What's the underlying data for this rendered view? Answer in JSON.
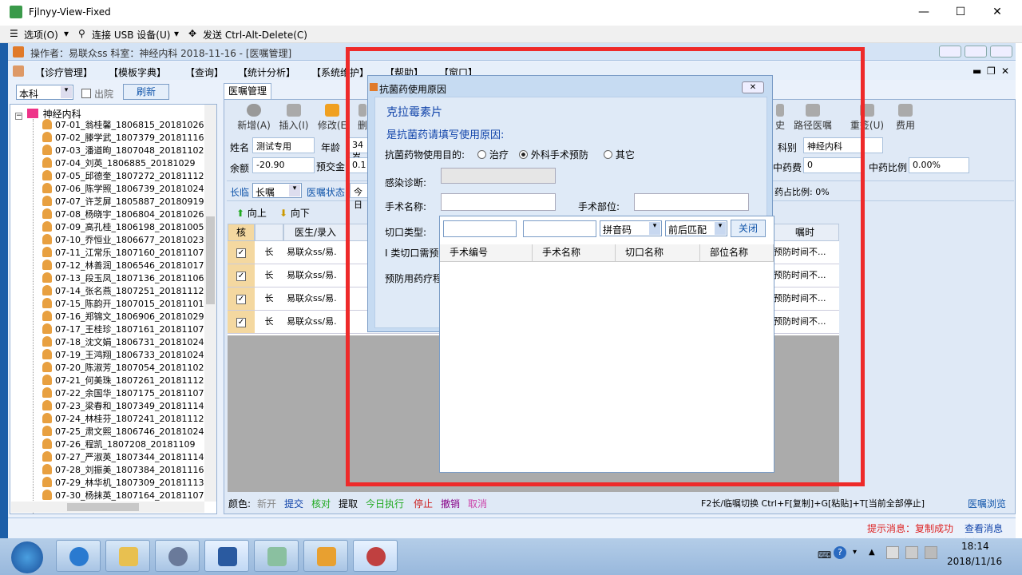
{
  "window": {
    "title": "Fjlnyy-View-Fixed",
    "minimize": "—",
    "maximize": "☐",
    "close": "✕"
  },
  "rdp_menu": {
    "options": "选项(O)",
    "usb": "连接 USB 设备(U)",
    "cad": "发送 Ctrl-Alt-Delete(C)"
  },
  "info": {
    "text": "操作者：易联众ss  科室：神经内科   2018-11-16 - [医嘱管理]"
  },
  "menus": [
    "【诊疗管理】",
    "【模板字典】",
    "【查询】",
    "【统计分析】",
    "【系统维护】",
    "【帮助】",
    "【窗口】"
  ],
  "left": {
    "dept_combo": "本科",
    "discharge_label": "出院",
    "refresh_button": "刷新",
    "root": "神经内科",
    "patients": [
      "07-01_翁桂馨_1806815_20181026",
      "07-02_滕学武_1807379_20181116",
      "07-03_潘道昫_1807048_20181102",
      "07-04_刘英_1806885_20181029",
      "07-05_邱德奎_1807272_20181112",
      "07-06_陈学照_1806739_20181024",
      "07-07_许芝屏_1805887_20180919",
      "07-08_杨晓宇_1806804_20181026",
      "07-09_高孔桂_1806198_20181005",
      "07-10_乔恒业_1806677_20181023",
      "07-11_江常乐_1807160_20181107",
      "07-12_林善润_1806546_20181017",
      "07-13_段玉凤_1807136_20181106",
      "07-14_张名燕_1807251_20181112",
      "07-15_陈韵开_1807015_20181101",
      "07-16_郑锦文_1806906_20181029",
      "07-17_王桂珍_1807161_20181107",
      "07-18_沈文娟_1806731_20181024",
      "07-19_王鸿翔_1806733_20181024",
      "07-20_陈淑芳_1807054_20181102",
      "07-21_何美珠_1807261_20181112",
      "07-22_余国华_1807175_20181107",
      "07-23_梁春和_1807349_20181114",
      "07-24_林桂芬_1807241_20181112",
      "07-25_肃文熙_1806746_20181024",
      "07-26_程凯_1807208_20181109",
      "07-27_严淑英_1807344_20181114",
      "07-28_刘振美_1807384_20181116",
      "07-29_林华机_1807309_20181113",
      "07-30_杨抹英_1807164_20181107"
    ]
  },
  "tab": "医嘱管理",
  "toolbar": {
    "new": "新增(A)",
    "insert": "插入(I)",
    "modify": "修改(E",
    "delete": "删",
    "history": "史",
    "path": "路径医嘱",
    "repeat": "重签(U)",
    "fee": "费用"
  },
  "form": {
    "name_label": "姓名",
    "name_value": "测试专用",
    "age_label": "年龄",
    "age_value": "34岁",
    "balance_label": "余额",
    "balance_value": "-20.90",
    "deposit_label": "预交金",
    "deposit_value": "0.1",
    "dept_label": "科别",
    "dept_value": "神经内科",
    "herb_fee_label": "中药费",
    "herb_fee_value": "0",
    "herb_ratio_label": "中药比例",
    "herb_ratio_value": "0.00%",
    "type_label": "长临",
    "type_value": "长嘱",
    "status_label": "医嘱状态",
    "status_value": "今日",
    "drug_ratio": "药占比例: 0%",
    "up": "向上",
    "down": "向下"
  },
  "grid": {
    "headers": [
      "核",
      "",
      "医生/录入",
      "",
      "嘱时"
    ],
    "rows": [
      {
        "type": "长",
        "doctor": "易联众ss/易.",
        "time": "预防时间不..."
      },
      {
        "type": "长",
        "doctor": "易联众ss/易.",
        "time": "预防时间不..."
      },
      {
        "type": "长",
        "doctor": "易联众ss/易.",
        "time": "预防时间不..."
      },
      {
        "type": "长",
        "doctor": "易联众ss/易.",
        "time": "预防时间不..."
      }
    ]
  },
  "status": {
    "color_label": "颜色:",
    "new": "新开",
    "submit": "提交",
    "check": "核对",
    "withdraw": "提取",
    "today": "今日执行",
    "stop": "停止",
    "undo": "撤销",
    "cancel": "取消",
    "shortcuts": "F2长/临嘱切换 Ctrl+F[复制]+G[粘贴]+T[当前全部停止]",
    "browse": "医嘱浏览",
    "hint": "提示消息：复制成功",
    "view_msgs": "查看消息>>"
  },
  "dialog": {
    "title": "抗菌药使用原因",
    "drug": "克拉霉素片",
    "prompt": "是抗菌药请填写使用原因:",
    "purpose_label": "抗菌药物使用目的:",
    "opt_treat": "治疗",
    "opt_prevent": "外科手术预防",
    "opt_other": "其它",
    "infection_label": "感染诊断:",
    "surgery_name_label": "手术名称:",
    "surgery_site_label": "手术部位:",
    "incision_label": "切口类型:",
    "class1_label": "I 类切口需预",
    "prevent_label": "预防用药疗程"
  },
  "popup": {
    "pinyin": "拼音码",
    "match": "前后匹配",
    "close": "关闭",
    "headers": [
      "手术编号",
      "手术名称",
      "切口名称",
      "部位名称"
    ]
  },
  "taskbar": {
    "time": "18:14",
    "date": "2018/11/16"
  }
}
